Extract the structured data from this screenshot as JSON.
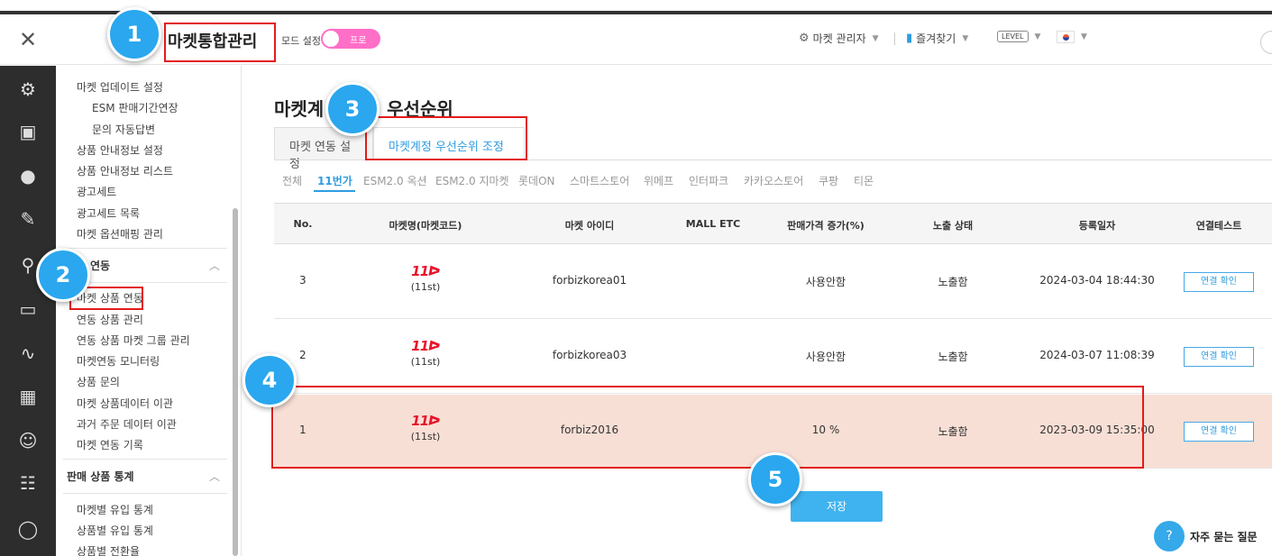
{
  "header": {
    "title": "마켓통합관리",
    "mode_label": "모드 설정",
    "mode_toggle_label": "프로",
    "market_manager": "마켓 관리자",
    "favorites": "즐겨찾기",
    "level": "LEVEL"
  },
  "sidebar": {
    "items_top": [
      {
        "label": "마켓 업데이트 설정",
        "sub": false
      },
      {
        "label": "ESM 판매기간연장",
        "sub": true
      },
      {
        "label": "문의 자동답변",
        "sub": true
      },
      {
        "label": "상품 안내정보 설정",
        "sub": false
      },
      {
        "label": "상품 안내정보 리스트",
        "sub": false
      },
      {
        "label": "광고세트",
        "sub": false
      },
      {
        "label": "광고세트 목록",
        "sub": false
      },
      {
        "label": "마켓 옵션매핑 관리",
        "sub": false
      }
    ],
    "group1": "연동",
    "items_mid": [
      "마켓 상품 연동",
      "연동 상품 관리",
      "연동 상품 마켓 그룹 관리",
      "마켓연동 모니터링",
      "상품 문의",
      "마켓 상품데이터 이관",
      "과거 주문 데이터 이관",
      "마켓 연동 기록"
    ],
    "group2": "판매 상품 통계",
    "items_bottom": [
      "마켓별 유입 통계",
      "상품별 유입 통계",
      "상품별 전환율"
    ]
  },
  "iconbar": [
    "gear-icon",
    "box-icon",
    "globe-icon",
    "edit-icon",
    "share-icon",
    "monitor-icon",
    "chart-icon",
    "calculator-icon",
    "users-icon",
    "sitemap-icon",
    "bulb-icon"
  ],
  "main": {
    "title_left": "마켓계",
    "title_right": "우선순위",
    "tabs": [
      "마켓 연동 설정",
      "마켓계정 우선순위 조정"
    ],
    "market_tabs": [
      "전체",
      "11번가",
      "ESM2.0 옥션",
      "ESM2.0 지마켓",
      "롯데ON",
      "스마트스토어",
      "위메프",
      "인터파크",
      "카카오스토어",
      "쿠팡",
      "티몬"
    ],
    "active_market_tab": "11번가",
    "columns": [
      "No.",
      "마켓명(마켓코드)",
      "마켓 아이디",
      "MALL ETC",
      "판매가격 증가(%)",
      "노출 상태",
      "등록일자",
      "연결테스트"
    ],
    "rows": [
      {
        "no": "3",
        "logo": "11",
        "code": "(11st)",
        "id": "forbizkorea01",
        "etc": "",
        "price": "사용안함",
        "status": "노출함",
        "date": "2024-03-04 18:44:30",
        "test": "연결 확인"
      },
      {
        "no": "2",
        "logo": "11",
        "code": "(11st)",
        "id": "forbizkorea03",
        "etc": "",
        "price": "사용안함",
        "status": "노출함",
        "date": "2024-03-07 11:08:39",
        "test": "연결 확인"
      },
      {
        "no": "1",
        "logo": "11",
        "code": "(11st)",
        "id": "forbiz2016",
        "etc": "",
        "price": "10 %",
        "status": "노출함",
        "date": "2023-03-09 15:35:00",
        "test": "연결 확인"
      }
    ],
    "save": "저장"
  },
  "faq": "자주 묻는 질문",
  "annotations": [
    "1",
    "2",
    "3",
    "4",
    "5"
  ],
  "colors": {
    "accent": "#2f9ce0",
    "highlight_row": "#f8dfd5",
    "annotation_red": "#e31b1b",
    "annotation_badge": "#2aa7ee",
    "toggle": "#ff6ec7"
  }
}
